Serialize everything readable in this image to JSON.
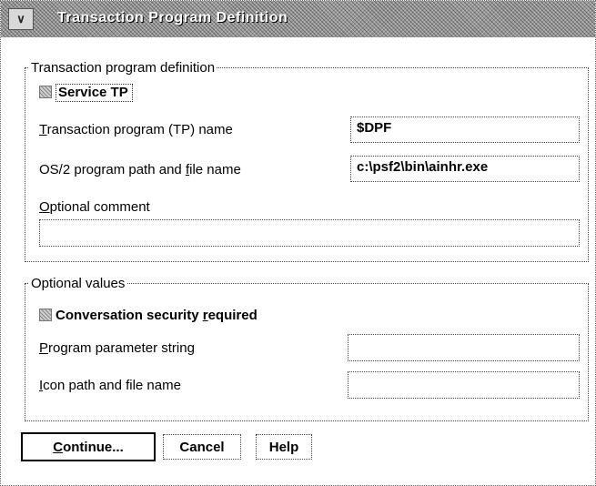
{
  "window": {
    "title": "Transaction Program Definition",
    "system_menu_icon": "system-menu-icon"
  },
  "tp_group": {
    "legend": "Transaction program definition",
    "service_tp": {
      "label": "Service TP",
      "checked": false
    },
    "tp_name": {
      "label_first": "T",
      "label_rest": "ransaction program (TP) name",
      "value": "$DPF"
    },
    "program_path": {
      "label_pre": "OS/2 program path and ",
      "label_u": "f",
      "label_post": "ile name",
      "value": "c:\\psf2\\bin\\ainhr.exe"
    },
    "comment": {
      "label_first": "O",
      "label_rest": "ptional comment",
      "value": ""
    }
  },
  "optional_group": {
    "legend": "Optional values",
    "security": {
      "label_pre": "Conversation security ",
      "label_u": "r",
      "label_post": "equired",
      "checked": false
    },
    "param_string": {
      "label_first": "P",
      "label_rest": "rogram parameter string",
      "value": ""
    },
    "icon_path": {
      "label_first": "I",
      "label_rest": "con path and file name",
      "value": ""
    }
  },
  "buttons": {
    "continue_first": "C",
    "continue_rest": "ontinue...",
    "cancel": "Cancel",
    "help": "Help"
  }
}
